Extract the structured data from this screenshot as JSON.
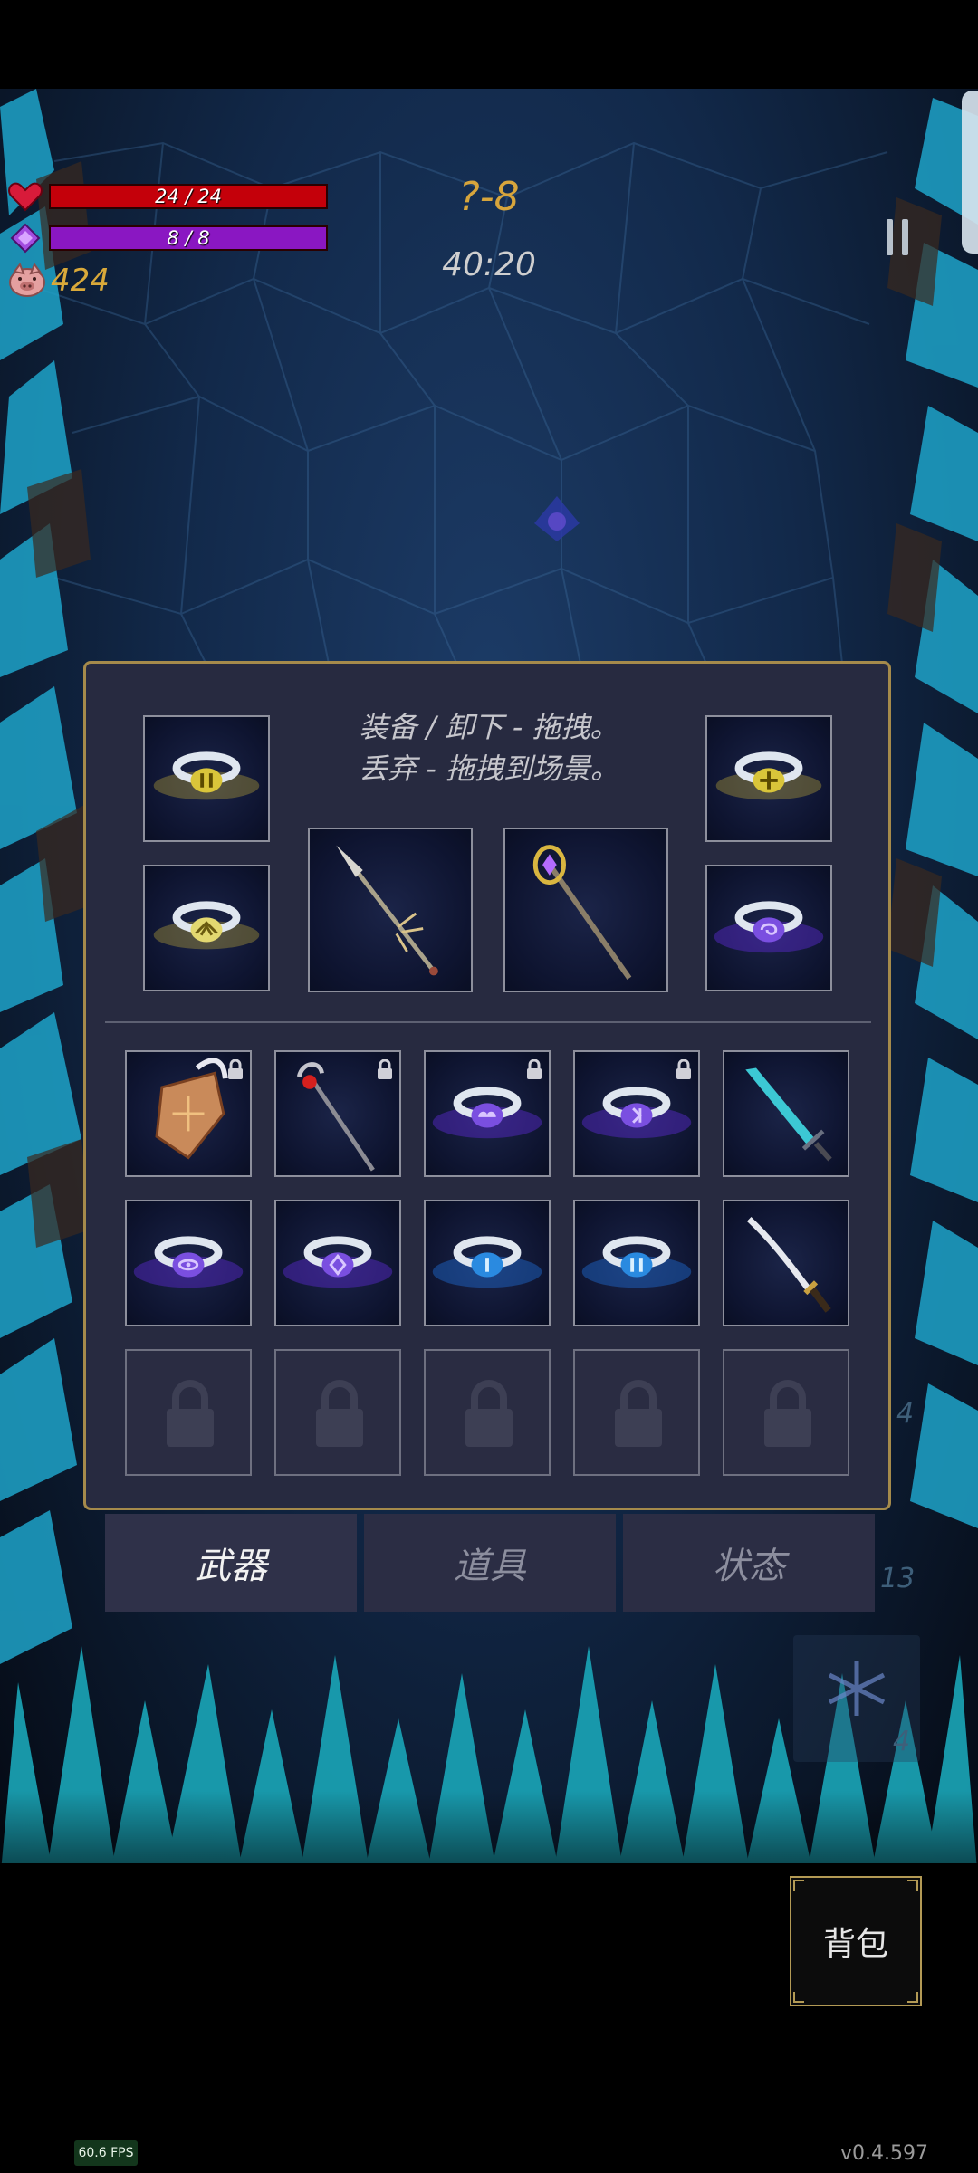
{
  "hud": {
    "hp_text": "24 / 24",
    "hp_fraction": 1.0,
    "mp_text": "8 / 8",
    "mp_fraction": 1.0,
    "gold": "424",
    "stage": "?-8",
    "timer": "40:20"
  },
  "panel": {
    "instruction_line1": "装备 / 卸下 - 拖拽。",
    "instruction_line2": "丢弃 - 拖拽到场景。",
    "equipped": [
      {
        "icon": "ring-yellow-gem-icon"
      },
      {
        "icon": "ring-yellow-cross-icon"
      },
      {
        "icon": "ring-yellow-shell-icon"
      },
      {
        "icon": "ring-purple-swirl-icon"
      },
      {
        "icon": "bone-spear-icon"
      },
      {
        "icon": "golden-staff-icon"
      }
    ],
    "inventory": [
      {
        "icon": "winged-shield-icon",
        "locked": true
      },
      {
        "icon": "ruby-staff-icon",
        "locked": true
      },
      {
        "icon": "ring-purple-cloud-icon",
        "locked": true
      },
      {
        "icon": "ring-purple-rune-icon",
        "locked": true
      },
      {
        "icon": "crystal-sword-icon",
        "locked": false
      },
      {
        "icon": "ring-purple-eye-icon",
        "locked": false
      },
      {
        "icon": "ring-purple-diamond-icon",
        "locked": false
      },
      {
        "icon": "ring-blue-line-icon",
        "locked": false
      },
      {
        "icon": "ring-blue-double-icon",
        "locked": false
      },
      {
        "icon": "katana-icon",
        "locked": false
      },
      {
        "icon": "empty-slot-lock-icon",
        "locked": true
      },
      {
        "icon": "empty-slot-lock-icon",
        "locked": true
      },
      {
        "icon": "empty-slot-lock-icon",
        "locked": true
      },
      {
        "icon": "empty-slot-lock-icon",
        "locked": true
      },
      {
        "icon": "empty-slot-lock-icon",
        "locked": true
      }
    ]
  },
  "tabs": [
    {
      "label": "武器",
      "active": true
    },
    {
      "label": "道具",
      "active": false
    },
    {
      "label": "状态",
      "active": false
    }
  ],
  "side": {
    "num_a": "4",
    "num_b": "13",
    "num_c": "4"
  },
  "bag_label": "背包",
  "fps": "60.6 FPS",
  "version": "v0.4.597",
  "colors": {
    "hp": "#c4000a",
    "mp": "#8a17c2",
    "gold": "#d9a93a",
    "panel_border": "#a58a4b",
    "panel_bg": "#272a40"
  }
}
